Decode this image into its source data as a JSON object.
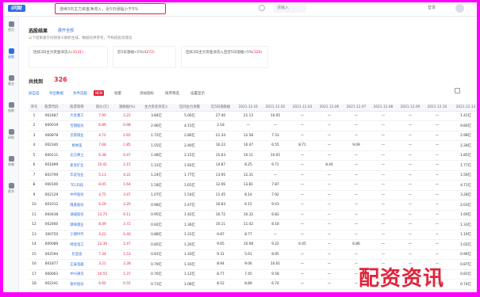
{
  "header": {
    "logo_text": "i问财",
    "search_text": "连续3日主力资金净流入，近5日涨幅小于5%",
    "top_pill": "请输入",
    "user_text": "登录"
  },
  "sidebar": {
    "items": [
      {
        "label": "首页",
        "icon": "home-icon"
      },
      {
        "label": "选股",
        "icon": "filter-icon"
      },
      {
        "label": "基金",
        "icon": "fund-icon"
      },
      {
        "label": "指数",
        "icon": "index-icon"
      },
      {
        "label": "研报",
        "icon": "report-icon"
      },
      {
        "label": "港美",
        "icon": "globe-icon"
      },
      {
        "label": "更多",
        "icon": "grid-icon"
      }
    ]
  },
  "section": {
    "title": "选股结果",
    "link": "展开全部",
    "desc": "以下结果基于问财语义解析生成，数据仅供参考，不构成投资建议"
  },
  "cards": [
    {
      "text": "连续3日主力资金净流入",
      "value": "(3131)"
    },
    {
      "text": "近5日涨幅<5%",
      "value": "(4272)"
    },
    {
      "text": "连续3日主力资金净流入且近5日涨幅<5%",
      "value": "(326)"
    }
  ],
  "results": {
    "label": "共找到",
    "count": "326"
  },
  "filters": [
    {
      "label": "加自选",
      "link": true
    },
    {
      "label": "导出数据",
      "link": true
    },
    {
      "label": "条件选股",
      "link": true
    },
    {
      "label": "批量",
      "link": false
    },
    {
      "label": "添加指标",
      "link": false
    },
    {
      "label": "排序筛选",
      "link": false
    },
    {
      "label": "设置显示",
      "link": false
    }
  ],
  "filter_badge": "NEW",
  "table": {
    "headers": [
      "序号",
      "股票代码",
      "股票简称",
      "现价(元)",
      "涨跌幅(%)",
      "主力资金净流入",
      "区间主力净额",
      "近5日涨跌幅",
      "2021.12.01",
      "2021.12.02",
      "2021.12.03",
      "2021.12.06",
      "2021.12.07",
      "2021.12.08",
      "2021.12.09",
      "2021.12.10",
      "2021.12.13"
    ],
    "rows": [
      [
        "1",
        "002487",
        "大金重工",
        "7.90",
        "2.22",
        "3.84亿",
        "5.06亿",
        "27.40",
        "21.13",
        "10.05",
        "—",
        "—",
        "—",
        "—",
        "—",
        "—",
        "1.41亿"
      ],
      [
        "2",
        "600019",
        "宝钢股份",
        "6.86",
        "0.98",
        "2.96亿",
        "4.15亿",
        "2.18",
        "—",
        "—",
        "—",
        "—",
        "—",
        "—",
        "—",
        "—",
        "9.80亿"
      ],
      [
        "3",
        "000878",
        "云南铜业",
        "4.72",
        "2.65",
        "1.72亿",
        "2.86亿",
        "21.34",
        "12.58",
        "7.33",
        "—",
        "—",
        "—",
        "—",
        "—",
        "—",
        "2.98亿"
      ],
      [
        "4",
        "002340",
        "格林美",
        "7.68",
        "1.85",
        "1.55亿",
        "2.40亿",
        "16.22",
        "10.47",
        "6.55",
        "8.71",
        "—",
        "9.09",
        "—",
        "—",
        "—",
        "2.28亿"
      ],
      [
        "5",
        "600111",
        "北方稀土",
        "6.38",
        "0.47",
        "1.48亿",
        "2.15亿",
        "15.03",
        "10.11",
        "10.05",
        "—",
        "—",
        "—",
        "—",
        "—",
        "—",
        "1.85亿"
      ],
      [
        "6",
        "601899",
        "紫金矿业",
        "10.41",
        "2.15",
        "1.31亿",
        "1.92亿",
        "14.87",
        "8.25",
        "9.71",
        "—",
        "8.44",
        "—",
        "—",
        "—",
        "—",
        "1.77亿"
      ],
      [
        "7",
        "603799",
        "华友钴业",
        "5.13",
        "4.22",
        "1.24亿",
        "1.77亿",
        "13.95",
        "12.31",
        "—",
        "—",
        "—",
        "—",
        "—",
        "—",
        "—",
        "1.56亿"
      ],
      [
        "8",
        "000100",
        "TCL科技",
        "8.45",
        "1.64",
        "1.18亿",
        "1.65亿",
        "12.06",
        "13.81",
        "7.87",
        "—",
        "—",
        "—",
        "—",
        "—",
        "—",
        "4.71亿"
      ],
      [
        "9",
        "002129",
        "中环股份",
        "4.75",
        "3.47",
        "1.07亿",
        "1.54亿",
        "11.45",
        "8.14",
        "7.92",
        "—",
        "—",
        "—",
        "—",
        "—",
        "—",
        "3.28亿"
      ],
      [
        "10",
        "601012",
        "隆基股份",
        "6.29",
        "2.20",
        "0.98亿",
        "1.47亿",
        "10.83",
        "6.15",
        "9.43",
        "—",
        "—",
        "—",
        "—",
        "—",
        "—",
        "2.03亿"
      ],
      [
        "11",
        "600438",
        "通威股份",
        "13.75",
        "0.11",
        "0.95亿",
        "1.42亿",
        "10.72",
        "10.32",
        "6.82",
        "—",
        "—",
        "—",
        "—",
        "—",
        "—",
        "1.69亿"
      ],
      [
        "12",
        "002460",
        "赣锋锂业",
        "8.49",
        "3.72",
        "0.92亿",
        "1.36亿",
        "10.11",
        "11.42",
        "8.18",
        "—",
        "—",
        "—",
        "—",
        "—",
        "—",
        "1.33亿"
      ],
      [
        "13",
        "300750",
        "宁德时代",
        "4.22",
        "0.40",
        "0.88亿",
        "1.31亿",
        "9.87",
        "8.77",
        "—",
        "—",
        "—",
        "—",
        "—",
        "—",
        "—",
        "1.19亿"
      ],
      [
        "14",
        "600089",
        "特变电工",
        "12.30",
        "2.47",
        "0.85亿",
        "1.26亿",
        "9.65",
        "10.08",
        "9.22",
        "6.45",
        "—",
        "6.86",
        "—",
        "—",
        "—",
        "1.02亿"
      ],
      [
        "15",
        "002594",
        "比亚迪",
        "7.34",
        "1.53",
        "0.81亿",
        "1.20亿",
        "9.31",
        "5.61",
        "8.95",
        "—",
        "—",
        "—",
        "—",
        "—",
        "—",
        "0.96亿"
      ],
      [
        "16",
        "601877",
        "正泰电器",
        "3.21",
        "2.28",
        "0.79亿",
        "1.16亿",
        "8.94",
        "9.06",
        "10.01",
        "—",
        "—",
        "—",
        "—",
        "—",
        "—",
        "0.87亿"
      ],
      [
        "17",
        "000063",
        "中兴通讯",
        "10.55",
        "1.37",
        "0.76亿",
        "1.12亿",
        "8.77",
        "7.45",
        "9.58",
        "—",
        "—",
        "—",
        "—",
        "—",
        "—",
        "0.81亿"
      ],
      [
        "18",
        "002241",
        "歌尔股份",
        "6.60",
        "0.55",
        "0.73亿",
        "1.08亿",
        "8.52",
        "8.89",
        "6.74",
        "—",
        "—",
        "—",
        "—",
        "—",
        "—",
        "0.74亿"
      ]
    ]
  },
  "watermark": "配资资讯",
  "colors": {
    "accent": "#2d6fe0",
    "up_red": "#e0243c",
    "page_border": "#ff00ff"
  }
}
